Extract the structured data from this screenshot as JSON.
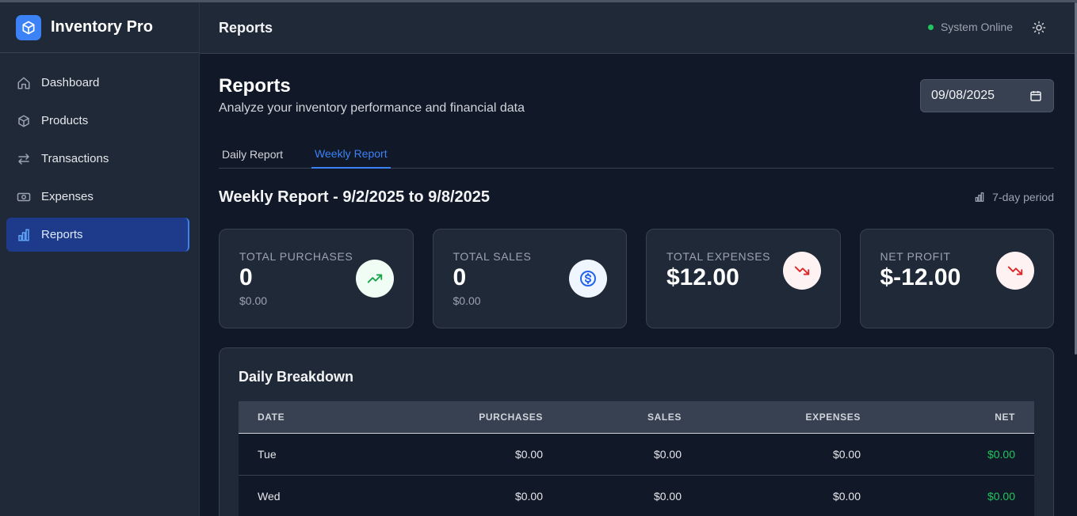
{
  "app": {
    "name": "Inventory Pro"
  },
  "sidebar": {
    "items": [
      {
        "label": "Dashboard",
        "icon": "home-icon"
      },
      {
        "label": "Products",
        "icon": "box-icon"
      },
      {
        "label": "Transactions",
        "icon": "arrows-exchange-icon"
      },
      {
        "label": "Expenses",
        "icon": "banknote-icon"
      },
      {
        "label": "Reports",
        "icon": "bar-chart-icon",
        "active": true
      }
    ]
  },
  "header": {
    "title": "Reports",
    "status": "System Online",
    "status_color": "#22c55e"
  },
  "page": {
    "title": "Reports",
    "subtitle": "Analyze your inventory performance and financial data",
    "date_value": "09/08/2025"
  },
  "tabs": [
    {
      "label": "Daily Report",
      "active": false
    },
    {
      "label": "Weekly Report",
      "active": true
    }
  ],
  "report": {
    "title": "Weekly Report - 9/2/2025 to 9/8/2025",
    "period": "7-day period"
  },
  "cards": [
    {
      "label": "Total Purchases",
      "value": "0",
      "sub": "$0.00",
      "icon": "trending-up-icon"
    },
    {
      "label": "Total Sales",
      "value": "0",
      "sub": "$0.00",
      "icon": "dollar-circle-icon"
    },
    {
      "label": "Total Expenses",
      "value": "$12.00",
      "sub": "",
      "icon": "trending-down-icon"
    },
    {
      "label": "Net Profit",
      "value": "$-12.00",
      "sub": "",
      "icon": "trending-down-icon"
    }
  ],
  "breakdown": {
    "title": "Daily Breakdown",
    "columns": [
      "Date",
      "Purchases",
      "Sales",
      "Expenses",
      "Net"
    ],
    "rows": [
      {
        "date": "Tue",
        "purchases": "$0.00",
        "sales": "$0.00",
        "expenses": "$0.00",
        "net": "$0.00"
      },
      {
        "date": "Wed",
        "purchases": "$0.00",
        "sales": "$0.00",
        "expenses": "$0.00",
        "net": "$0.00"
      }
    ]
  },
  "colors": {
    "accent": "#3b82f6",
    "positive": "#22c55e",
    "negative": "#dc2626"
  }
}
